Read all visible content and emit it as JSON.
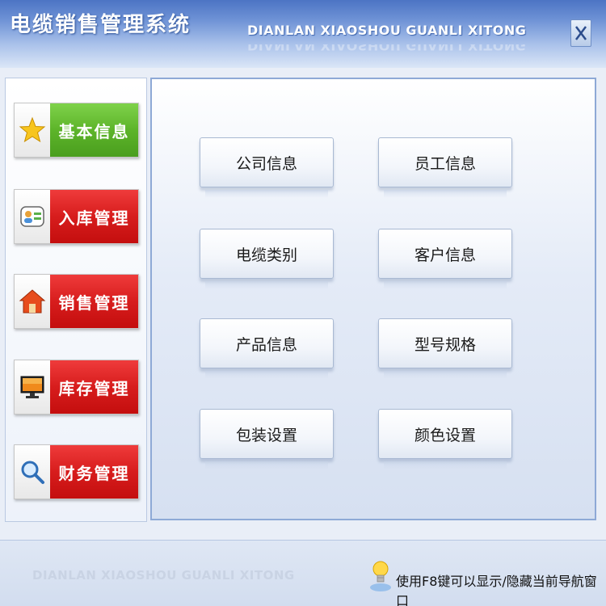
{
  "window": {
    "title": "电缆销售管理系统",
    "subtitle": "DIANLAN XIAOSHOU GUANLI XITONG",
    "close_icon": "close-icon"
  },
  "nav": {
    "items": [
      {
        "label": "基本信息",
        "icon": "star-icon",
        "color": "green"
      },
      {
        "label": "入库管理",
        "icon": "contacts-card-icon",
        "color": "red"
      },
      {
        "label": "销售管理",
        "icon": "home-icon",
        "color": "red"
      },
      {
        "label": "库存管理",
        "icon": "monitor-icon",
        "color": "red"
      },
      {
        "label": "财务管理",
        "icon": "magnifier-icon",
        "color": "red"
      }
    ]
  },
  "content": {
    "buttons": [
      {
        "label": "公司信息"
      },
      {
        "label": "员工信息"
      },
      {
        "label": "电缆类别"
      },
      {
        "label": "客户信息"
      },
      {
        "label": "产品信息"
      },
      {
        "label": "型号规格"
      },
      {
        "label": "包装设置"
      },
      {
        "label": "颜色设置"
      }
    ]
  },
  "status": {
    "brand": "DIANLAN XIAOSHOU GUANLI XITONG",
    "hint": "使用F8键可以显示/隐藏当前导航窗口",
    "hint_icon": "lightbulb-icon"
  },
  "colors": {
    "nav_green": "#5db42a",
    "nav_red": "#d71d1d",
    "title_blue": "#4c74c4"
  }
}
